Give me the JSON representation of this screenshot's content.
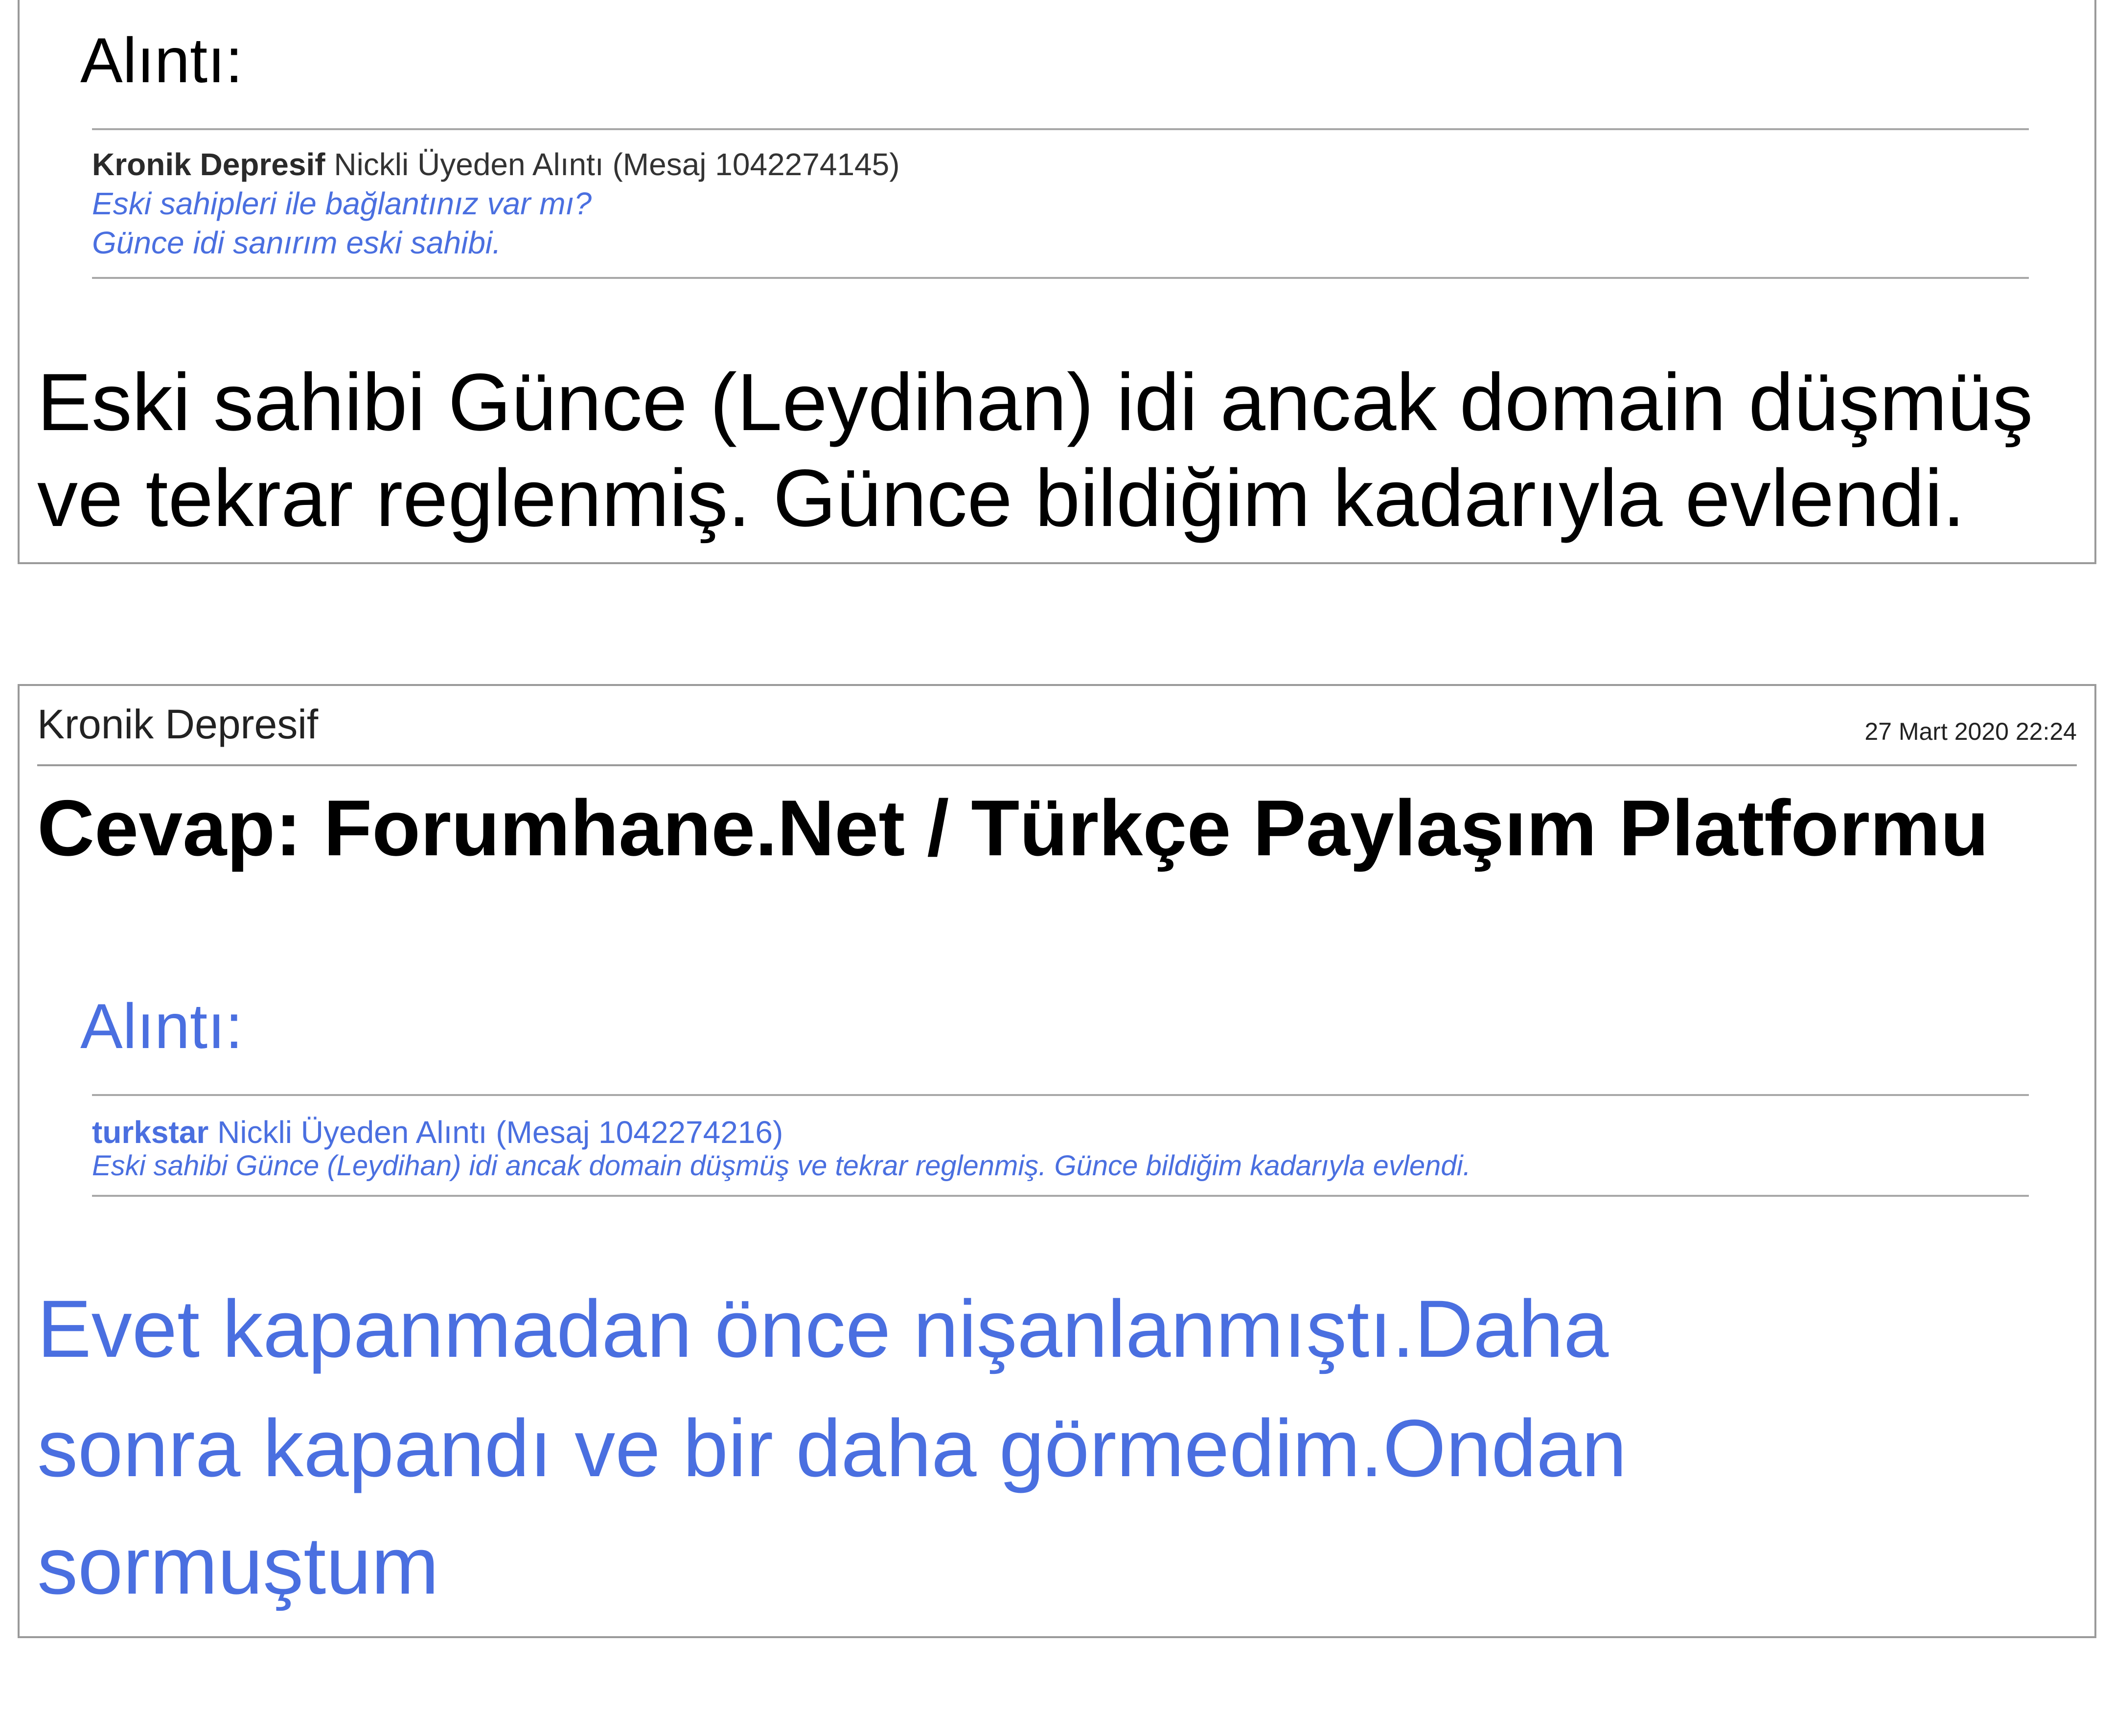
{
  "post1": {
    "quote_label": "Alıntı:",
    "quote": {
      "author": "Kronik Depresif",
      "source_suffix": " Nickli Üyeden Alıntı (Mesaj 1042274145)",
      "lines": [
        "Eski sahipleri ile bağlantınız var mı?",
        "Günce idi sanırım eski sahibi."
      ]
    },
    "body_lines": [
      "Eski sahibi Günce (Leydihan) idi ancak domain düşmüş",
      "ve tekrar reglenmiş. Günce bildiğim kadarıyla evlendi."
    ]
  },
  "post2": {
    "author": "Kronik Depresif",
    "date": "27 Mart 2020 22:24",
    "title": "Cevap: Forumhane.Net / Türkçe Paylaşım Platformu",
    "quote_label": "Alıntı:",
    "quote": {
      "author": "turkstar",
      "source_suffix": " Nickli Üyeden Alıntı (Mesaj 1042274216)",
      "lines": [
        "Eski sahibi Günce (Leydihan) idi ancak domain düşmüş ve tekrar reglenmiş. Günce bildiğim kadarıyla evlendi."
      ]
    },
    "body_lines": [
      "Evet kapanmadan önce nişanlanmıştı.Daha",
      "sonra kapandı ve bir daha görmedim.Ondan",
      "sormuştum"
    ]
  },
  "colors": {
    "accent_blue": "#4a6fe0",
    "border_gray": "#9a9a9a"
  }
}
